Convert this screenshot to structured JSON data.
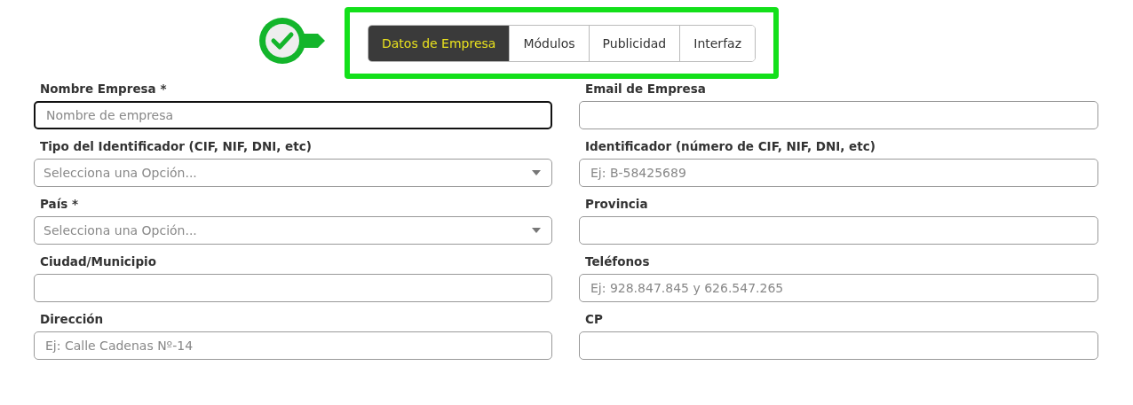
{
  "tabs": [
    {
      "label": "Datos de Empresa",
      "selected": true
    },
    {
      "label": "Módulos",
      "selected": false
    },
    {
      "label": "Publicidad",
      "selected": false
    },
    {
      "label": "Interfaz",
      "selected": false
    }
  ],
  "fields": [
    {
      "label": "Nombre Empresa *",
      "kind": "text",
      "placeholder": "Nombre de empresa",
      "focused": true
    },
    {
      "label": "Email de Empresa",
      "kind": "text",
      "focused": false
    },
    {
      "label": "Tipo del Identificador (CIF, NIF, DNI, etc)",
      "kind": "select",
      "placeholder": "Selecciona una Opción...",
      "focused": false
    },
    {
      "label": "Identificador (número de CIF, NIF, DNI, etc)",
      "kind": "text",
      "placeholder": "Ej: B-58425689",
      "focused": false
    },
    {
      "label": "País *",
      "kind": "select",
      "placeholder": "Selecciona una Opción...",
      "focused": false
    },
    {
      "label": "Provincia",
      "kind": "text",
      "focused": false
    },
    {
      "label": "Ciudad/Municipio",
      "kind": "text",
      "focused": false
    },
    {
      "label": "Teléfonos",
      "kind": "text",
      "placeholder": "Ej: 928.847.845 y 626.547.265",
      "focused": false
    },
    {
      "label": "Dirección",
      "kind": "text",
      "placeholder": "Ej: Calle Cadenas Nº-14",
      "focused": false
    },
    {
      "label": "CP",
      "kind": "text",
      "focused": false
    }
  ]
}
